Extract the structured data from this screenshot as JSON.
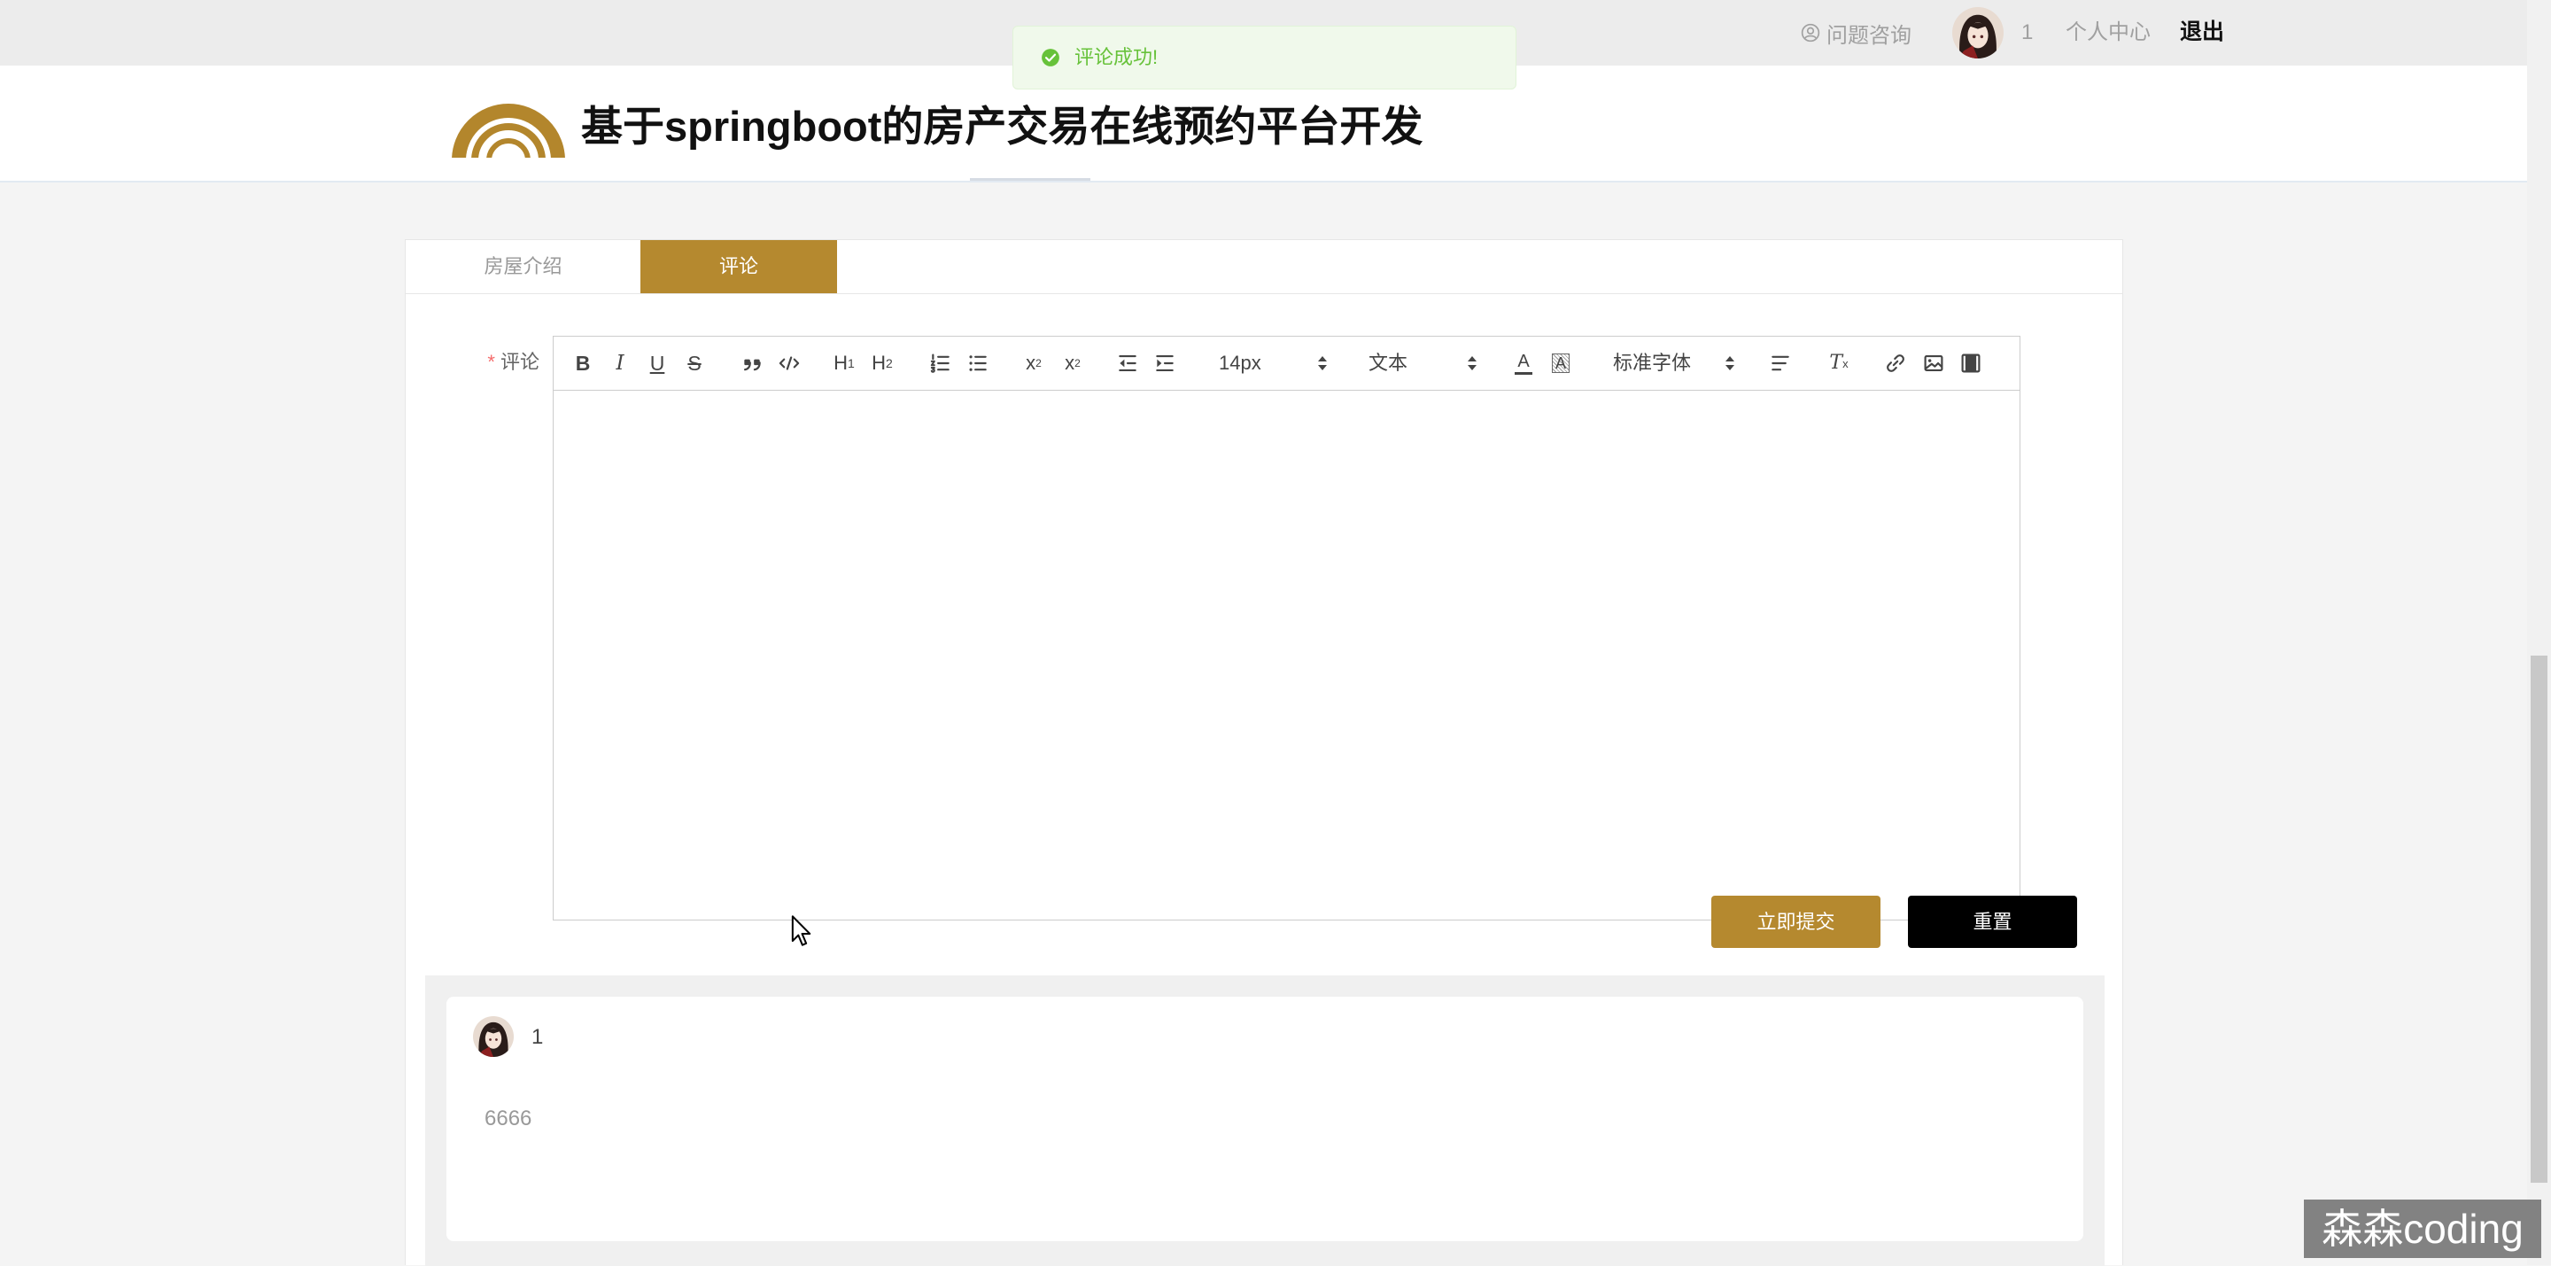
{
  "topbar": {
    "help": {
      "icon": "user-circle-icon",
      "label": "问题咨询"
    },
    "avatar": "avatar",
    "username": "1",
    "profile_label": "个人中心",
    "logout_label": "退出"
  },
  "toast": {
    "icon": "success-check-icon",
    "message": "评论成功!"
  },
  "header": {
    "logo": "arc-logo",
    "title": "基于springboot的房产交易在线预约平台开发"
  },
  "tabs": [
    {
      "label": "房屋介绍",
      "active": false
    },
    {
      "label": "评论",
      "active": true
    }
  ],
  "form": {
    "required_mark": "*",
    "label": "评论"
  },
  "editor": {
    "toolbar": {
      "items": [
        {
          "name": "bold-icon",
          "glyph": "B"
        },
        {
          "name": "italic-icon",
          "glyph": "I"
        },
        {
          "name": "underline-icon",
          "glyph": "U"
        },
        {
          "name": "strike-icon",
          "glyph": "S"
        },
        {
          "name": "blockquote-icon"
        },
        {
          "name": "code-block-icon"
        },
        {
          "name": "header-1-icon",
          "glyph": "H",
          "sub": "1"
        },
        {
          "name": "header-2-icon",
          "glyph": "H",
          "sub": "2"
        },
        {
          "name": "ordered-list-icon"
        },
        {
          "name": "bullet-list-icon"
        },
        {
          "name": "subscript-icon",
          "glyph": "x",
          "sub": "2"
        },
        {
          "name": "superscript-icon",
          "glyph": "x",
          "sup": "2"
        },
        {
          "name": "outdent-icon"
        },
        {
          "name": "indent-icon"
        },
        {
          "name": "font-color-icon",
          "glyph": "A"
        },
        {
          "name": "background-color-icon",
          "glyph": "A"
        },
        {
          "name": "align-icon"
        },
        {
          "name": "clean-format-icon",
          "glyph": "T",
          "sub": "x"
        },
        {
          "name": "link-icon"
        },
        {
          "name": "image-icon"
        },
        {
          "name": "video-icon"
        }
      ],
      "size_select": {
        "value": "14px"
      },
      "header_select": {
        "value": "文本"
      },
      "font_select": {
        "value": "标准字体"
      }
    },
    "content": ""
  },
  "buttons": {
    "submit": "立即提交",
    "reset": "重置"
  },
  "comments": [
    {
      "username": "1",
      "content": "6666"
    }
  ],
  "watermark": "森森coding",
  "colors": {
    "accent": "#b5892f",
    "success": "#67c23a",
    "dark": "#000000",
    "required": "#f56c6c"
  }
}
